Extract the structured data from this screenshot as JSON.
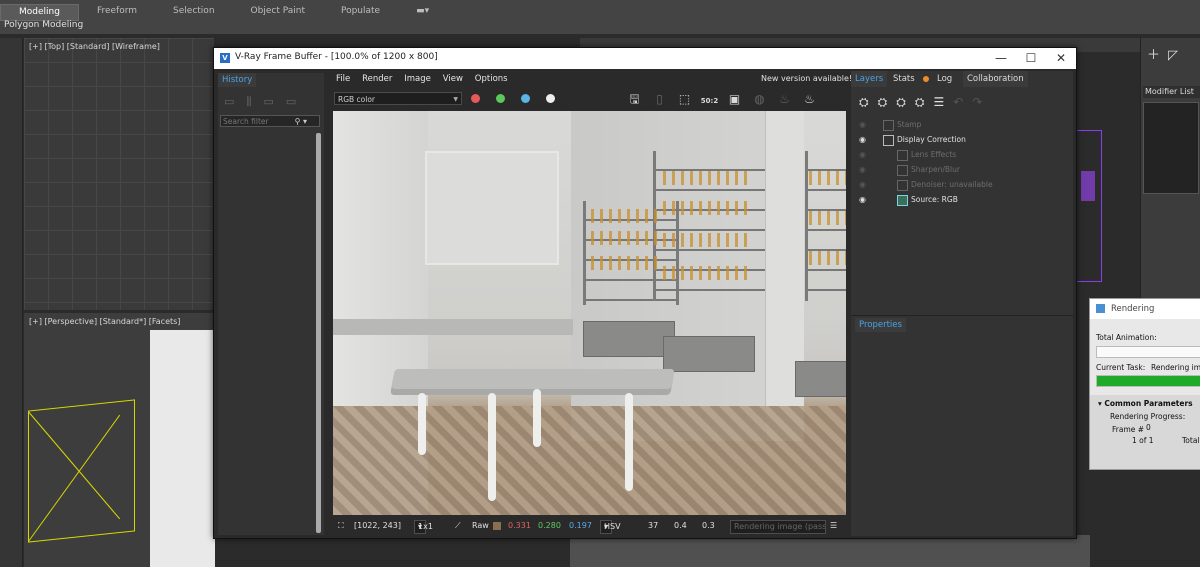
{
  "ribbon": {
    "tabs": [
      "Modeling",
      "Freeform",
      "Selection",
      "Object Paint",
      "Populate"
    ],
    "subtitle": "Polygon Modeling"
  },
  "viewports": {
    "top_label": "[+] [Top] [Standard] [Wireframe]",
    "persp_label": "[+] [Perspective] [Standard*] [Facets]"
  },
  "command_panel": {
    "modifier_list": "Modifier List"
  },
  "vfb": {
    "title": "V-Ray Frame Buffer - [100.0% of 1200 x 800]",
    "controls": {
      "minimize": "—",
      "maximize": "☐",
      "close": "✕"
    },
    "history": {
      "tab": "History",
      "search_placeholder": "Search filter"
    },
    "menu": [
      "File",
      "Render",
      "Image",
      "View",
      "Options"
    ],
    "new_version": "New version available!",
    "channel": "RGB color",
    "colors": {
      "red": "#e45a5a",
      "green": "#5ac85a",
      "blue": "#5ab4e4",
      "accent": "#4aa3e8"
    },
    "toolbar_icons": [
      "save-icon",
      "save-all-icon",
      "region-icon",
      "zoom-50-icon",
      "clear-icon",
      "render-icon",
      "teapot-icon",
      "stop-icon",
      "render-interactive-icon"
    ],
    "zoom_label": "50:2",
    "status": {
      "coords": "[1022, 243]",
      "zoom": "1x1",
      "raw_label": "Raw",
      "r": "0.331",
      "g": "0.280",
      "b": "0.197",
      "mode": "HSV",
      "h": "37",
      "s": "0.4",
      "v": "0.3",
      "progress_text": "Rendering image (pass"
    },
    "right_tabs": [
      "Layers",
      "Stats",
      "Log",
      "Collaboration"
    ],
    "layers": [
      {
        "name": "Stamp",
        "visible": false
      },
      {
        "name": "Display Correction",
        "visible": true
      },
      {
        "name": "Lens Effects",
        "visible": false
      },
      {
        "name": "Sharpen/Blur",
        "visible": false
      },
      {
        "name": "Denoiser: unavailable",
        "visible": false
      },
      {
        "name": "Source: RGB",
        "visible": true
      }
    ],
    "properties_tab": "Properties"
  },
  "rendering_dialog": {
    "title": "Rendering",
    "total_animation_label": "Total Animation:",
    "total_animation_progress": 0,
    "current_task_label": "Current Task:",
    "current_task_value": "Rendering ima",
    "current_task_progress": 0.95,
    "common_parameters": "Common Parameters",
    "rendering_progress": "Rendering Progress:",
    "frame_label": "Frame #",
    "frame_value": "0",
    "of_value": "1 of 1",
    "total_label": "Total"
  }
}
